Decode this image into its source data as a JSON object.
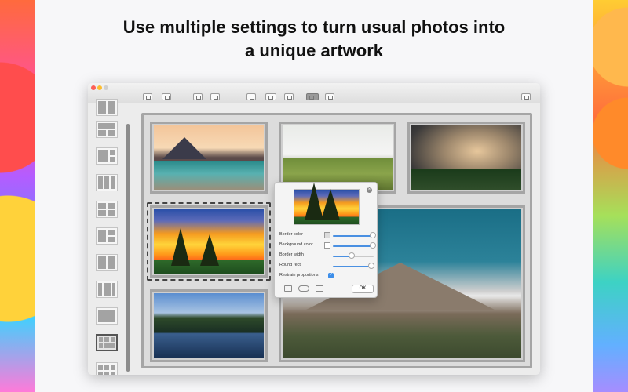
{
  "headline": {
    "line1": "Use multiple settings to turn usual photos into",
    "line2": "a unique artwork"
  },
  "toolbar": {
    "buttons": [
      "add-photo-icon",
      "add-image-icon",
      "import-icon",
      "export-icon",
      "arrange-icon",
      "spin-icon",
      "crop-icon",
      "layout-icon",
      "text-icon",
      "share-icon"
    ],
    "active": "layout-icon"
  },
  "sidebar": {
    "layouts": [
      "layout-1",
      "layout-2",
      "layout-3",
      "layout-4",
      "layout-5",
      "layout-6",
      "layout-7",
      "layout-8",
      "layout-9",
      "layout-10",
      "layout-11"
    ],
    "selected": "layout-10"
  },
  "canvas": {
    "photos": [
      {
        "name": "photo-mountain-lake"
      },
      {
        "name": "photo-meadow"
      },
      {
        "name": "photo-storm-clouds"
      },
      {
        "name": "photo-sunset-trees",
        "selected": true
      },
      {
        "name": "photo-big-mountain"
      },
      {
        "name": "photo-forest-lake"
      }
    ]
  },
  "popover": {
    "border_color_label": "Border color",
    "background_color_label": "Background color",
    "border_width_label": "Border width",
    "round_rect_label": "Round rect",
    "restrain_label": "Restrain proportions",
    "ok_label": "OK",
    "border_color_level": 1.0,
    "background_color_level": 1.0,
    "border_width_level": 0.45,
    "round_rect_level": 0.95,
    "restrain_checked": true,
    "accent": "#4a90e2"
  }
}
